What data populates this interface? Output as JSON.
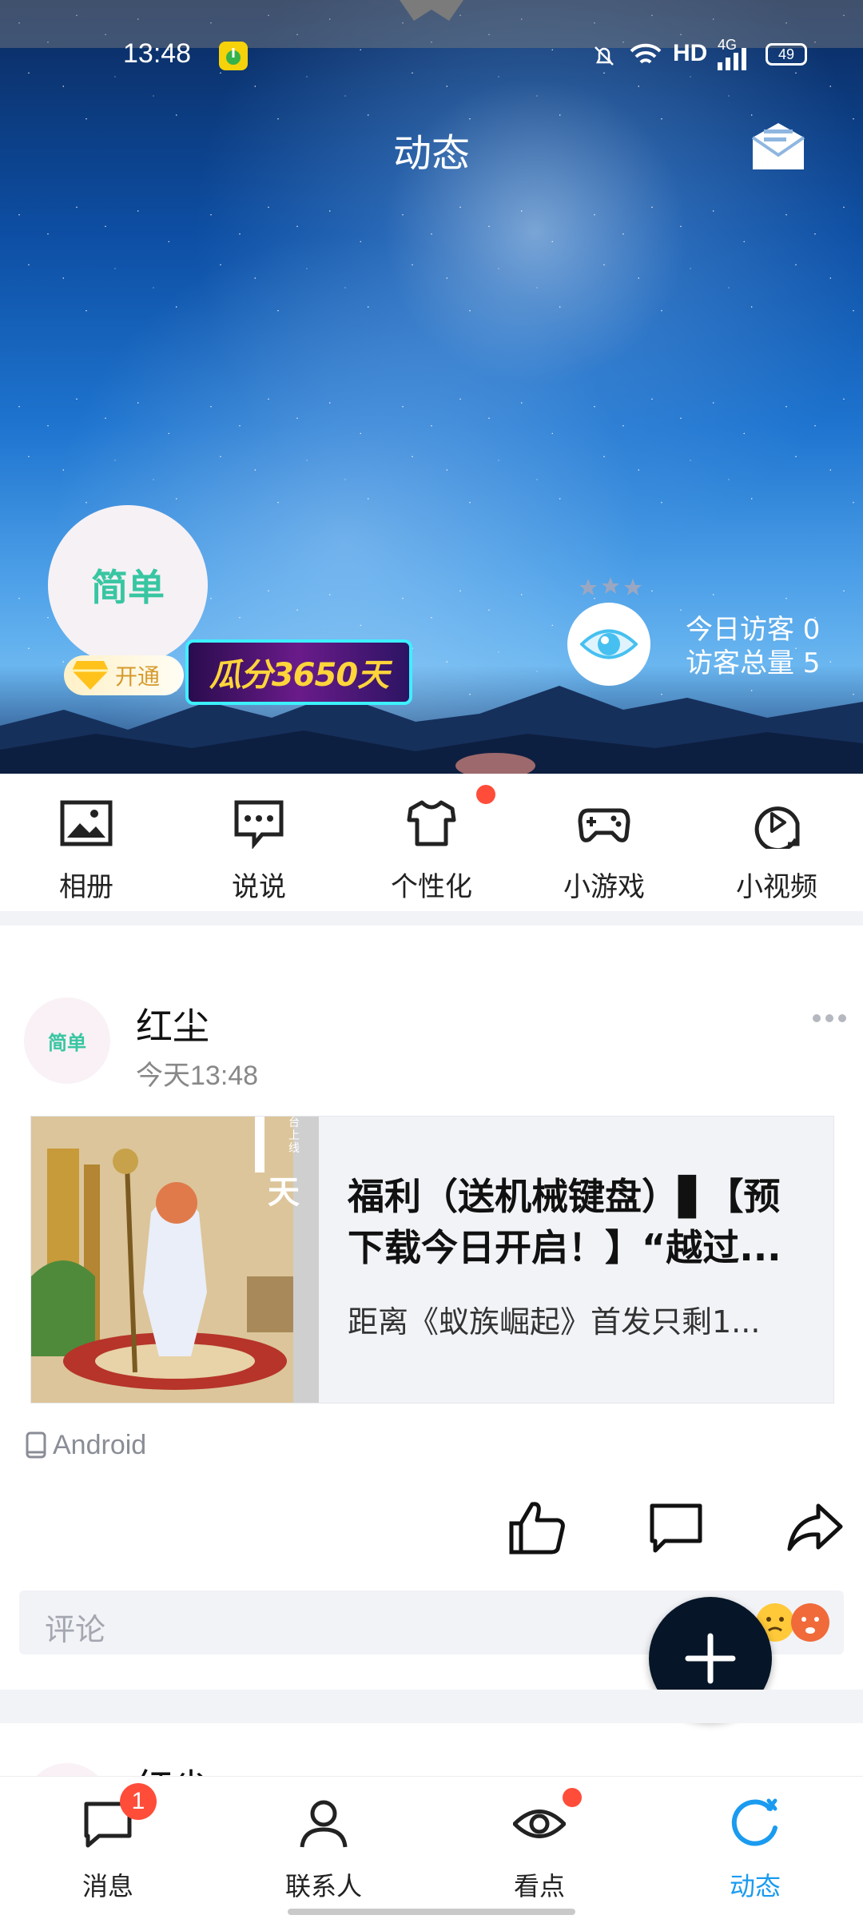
{
  "status_bar": {
    "time": "13:48",
    "network_label": "HD",
    "signal_label": "4G",
    "battery": "49"
  },
  "header": {
    "title": "动态"
  },
  "profile": {
    "avatar_text": "简单",
    "vip_label": "开通",
    "promo_text": "瓜分3650天",
    "visitors_today_label": "今日访客 0",
    "visitors_total_label": "访客总量 5"
  },
  "features": [
    {
      "label": "相册",
      "icon": "album-icon"
    },
    {
      "label": "说说",
      "icon": "chat-bubble-icon"
    },
    {
      "label": "个性化",
      "icon": "tshirt-icon",
      "has_dot": true
    },
    {
      "label": "小游戏",
      "icon": "gamepad-icon"
    },
    {
      "label": "小视频",
      "icon": "video-play-icon"
    }
  ],
  "post": {
    "avatar_text": "简单",
    "author": "红尘",
    "time": "今天13:48",
    "card_title": "福利（送机械键盘）▋【预下载今日开启！】“越过...",
    "card_subtitle": "距离《蚁族崛起》首发只剩1...",
    "card_image_text": "天",
    "card_image_side_text": "台上线",
    "device": "Android"
  },
  "comment": {
    "placeholder": "评论"
  },
  "post2": {
    "author": "红尘"
  },
  "bottom_nav": [
    {
      "label": "消息",
      "icon": "message-icon",
      "badge": "1"
    },
    {
      "label": "联系人",
      "icon": "contacts-icon"
    },
    {
      "label": "看点",
      "icon": "eye-icon",
      "has_dot": true
    },
    {
      "label": "动态",
      "icon": "feed-refresh-icon",
      "active": true
    }
  ],
  "colors": {
    "accent": "#1a9bf0",
    "badge_red": "#ff4d3a",
    "fab": "#061628"
  }
}
